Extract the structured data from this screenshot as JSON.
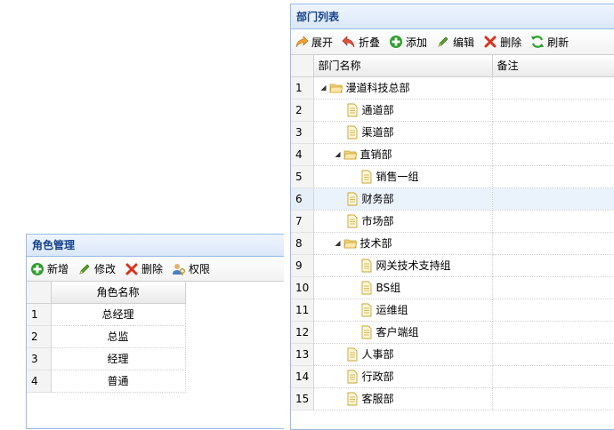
{
  "role_panel": {
    "title": "角色管理",
    "toolbar": {
      "add": "新增",
      "edit": "修改",
      "delete": "删除",
      "perm": "权限"
    },
    "column": "角色名称",
    "rows": [
      {
        "num": "1",
        "name": "总经理"
      },
      {
        "num": "2",
        "name": "总监"
      },
      {
        "num": "3",
        "name": "经理"
      },
      {
        "num": "4",
        "name": "普通"
      }
    ]
  },
  "dept_panel": {
    "title": "部门列表",
    "toolbar": {
      "expand": "展开",
      "collapse": "折叠",
      "add": "添加",
      "edit": "编辑",
      "delete": "删除",
      "refresh": "刷新"
    },
    "columns": {
      "name": "部门名称",
      "remark": "备注"
    },
    "rows": [
      {
        "num": "1",
        "name": "漫道科技总部",
        "type": "folder"
      },
      {
        "num": "2",
        "name": "通道部",
        "type": "file"
      },
      {
        "num": "3",
        "name": "渠道部",
        "type": "file"
      },
      {
        "num": "4",
        "name": "直销部",
        "type": "folder"
      },
      {
        "num": "5",
        "name": "销售一组",
        "type": "file"
      },
      {
        "num": "6",
        "name": "财务部",
        "type": "file",
        "selected": true
      },
      {
        "num": "7",
        "name": "市场部",
        "type": "file"
      },
      {
        "num": "8",
        "name": "技术部",
        "type": "folder"
      },
      {
        "num": "9",
        "name": "网关技术支持组",
        "type": "file"
      },
      {
        "num": "10",
        "name": "BS组",
        "type": "file"
      },
      {
        "num": "11",
        "name": "运维组",
        "type": "file"
      },
      {
        "num": "12",
        "name": "客户端组",
        "type": "file"
      },
      {
        "num": "13",
        "name": "人事部",
        "type": "file"
      },
      {
        "num": "14",
        "name": "行政部",
        "type": "file"
      },
      {
        "num": "15",
        "name": "客服部",
        "type": "file"
      }
    ]
  }
}
